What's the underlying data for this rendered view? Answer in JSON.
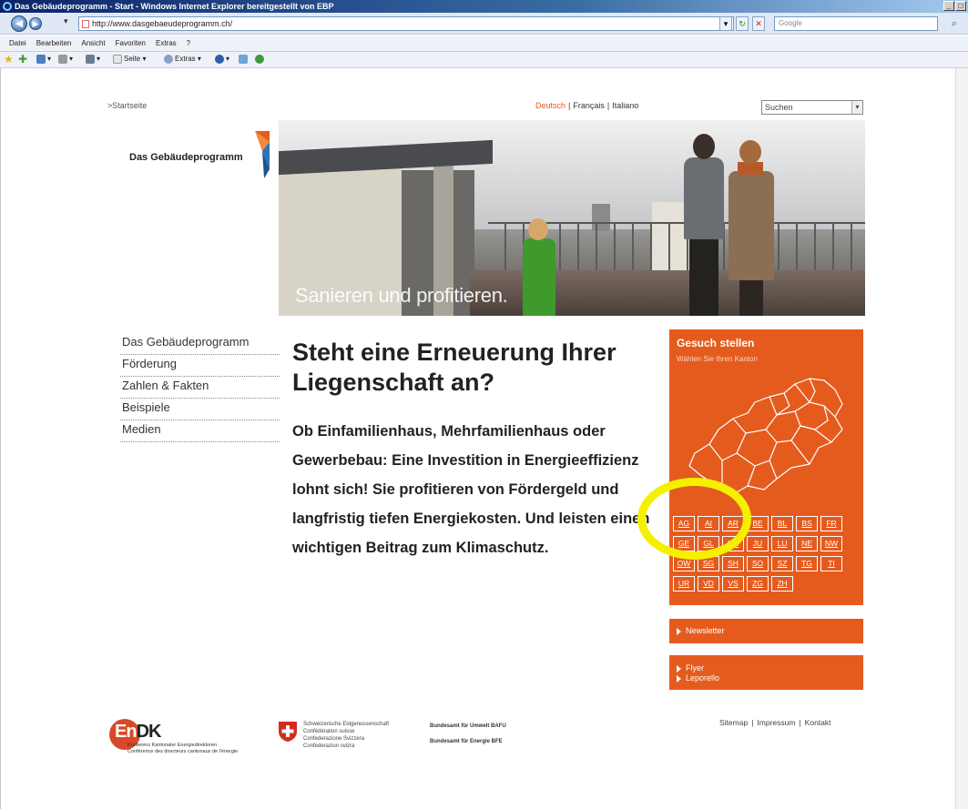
{
  "window": {
    "title": "Das Gebäudeprogramm - Start - Windows Internet Explorer bereitgestellt von EBP"
  },
  "address": {
    "url": "http://www.dasgebaeudeprogramm.ch/",
    "search_placeholder": "Google"
  },
  "menu": [
    "Datei",
    "Bearbeiten",
    "Ansicht",
    "Favoriten",
    "Extras",
    "?"
  ],
  "commandbar": {
    "page_label": "Seite",
    "tools_label": "Extras"
  },
  "page": {
    "breadcrumb": ">Startseite",
    "languages": {
      "active": "Deutsch",
      "fr": "Français",
      "it": "Italiano"
    },
    "site_search": "Suchen",
    "logo_text": "Das Gebäudeprogramm",
    "hero_slogan": "Sanieren und profitieren.",
    "nav": [
      "Das Gebäudeprogramm",
      "Förderung",
      "Zahlen & Fakten",
      "Beispiele",
      "Medien"
    ],
    "heading": "Steht eine Erneuerung Ihrer Liegenschaft an?",
    "body": "Ob Einfamilienhaus, Mehrfamilienhaus oder Gewerbebau: Eine Investition in Energieeffizienz lohnt sich! Sie profitieren von Fördergeld und langfristig tiefen Energiekosten. Und leisten einen wichtigen Beitrag zum Klimaschutz.",
    "gesuch": {
      "title": "Gesuch stellen",
      "subtitle": "Wählen Sie Ihren Kanton",
      "cantons": [
        [
          "AG",
          "AI",
          "AR",
          "BE",
          "BL",
          "BS",
          "FR"
        ],
        [
          "GE",
          "GL",
          "GR",
          "JU",
          "LU",
          "NE",
          "NW"
        ],
        [
          "OW",
          "SG",
          "SH",
          "SO",
          "SZ",
          "TG",
          "TI"
        ],
        [
          "UR",
          "VD",
          "VS",
          "ZG",
          "ZH"
        ]
      ]
    },
    "newsletter": "Newsletter",
    "flyer": "Flyer",
    "leporello": "Leporello",
    "footer_links": [
      "Sitemap",
      "Impressum",
      "Kontakt"
    ],
    "endk": {
      "line1": "Konferenz Kantonaler Energiedirektoren",
      "line2": "Conférence des directeurs cantonaux de l'énergie"
    },
    "confed": [
      "Schweizerische Eidgenossenschaft",
      "Confédération suisse",
      "Confederazione Svizzera",
      "Confederaziun svizra"
    ],
    "bafu": "Bundesamt für Umwelt BAFU",
    "bfe": "Bundesamt für Energie BFE"
  },
  "colors": {
    "accent": "#e55b1e",
    "highlight": "#f5f000"
  }
}
